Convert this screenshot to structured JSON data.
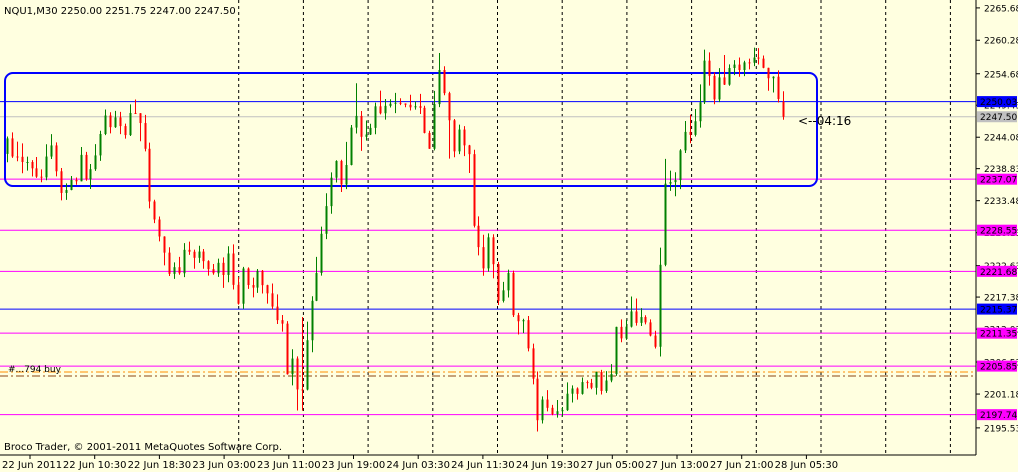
{
  "chart_data": {
    "type": "candlestick",
    "title": "NQU1,M30  2250.00 2251.75 2247.00 2247.50",
    "watermark": "Broco Trader, © 2001-2011 MetaQuotes Software Corp.",
    "countdown_label": "<--04:16",
    "trade_label": "#...794 buy",
    "y_ticks": [
      "2265.68",
      "2260.28",
      "2254.68",
      "2249.43",
      "2244.08",
      "2238.83",
      "2233.48",
      "2228.13",
      "2222.63",
      "2217.38",
      "2212.03",
      "2206.53",
      "2201.18",
      "2195.53"
    ],
    "x_ticks": [
      "22 Jun 2011",
      "22 Jun 10:30",
      "22 Jun 18:30",
      "23 Jun 03:00",
      "23 Jun 11:00",
      "23 Jun 19:00",
      "24 Jun 03:30",
      "24 Jun 11:30",
      "24 Jun 19:30",
      "27 Jun 05:00",
      "27 Jun 13:00",
      "27 Jun 21:00",
      "28 Jun 05:30"
    ],
    "ylim": [
      2191,
      2267
    ],
    "horizontal_lines": [
      {
        "price": 2250.03,
        "label": "2250.03",
        "color": "#0000ff"
      },
      {
        "price": 2247.5,
        "label": "2247.50",
        "color": "#c0c0c0"
      },
      {
        "price": 2237.07,
        "label": "2237.07",
        "color": "#ff00ff"
      },
      {
        "price": 2228.55,
        "label": "2228.55",
        "color": "#ff00ff"
      },
      {
        "price": 2221.68,
        "label": "2221.68",
        "color": "#ff00ff"
      },
      {
        "price": 2215.37,
        "label": "2215.37",
        "color": "#0000ff"
      },
      {
        "price": 2211.35,
        "label": "2211.35",
        "color": "#ff00ff"
      },
      {
        "price": 2205.85,
        "label": "2205.85",
        "color": "#ff00ff"
      },
      {
        "price": 2197.74,
        "label": "2197.74",
        "color": "#ff00ff"
      }
    ],
    "candles": [
      [
        2241.29,
        2243.88,
        2239.9,
        2244.2
      ],
      [
        2243.88,
        2240.86,
        2240.62,
        2244.88
      ],
      [
        2240.86,
        2240.81,
        2240.06,
        2243.34
      ],
      [
        2240.81,
        2239.94,
        2238.07,
        2243.05
      ],
      [
        2239.94,
        2239.94,
        2238.51,
        2240.84
      ],
      [
        2239.94,
        2238.88,
        2237.51,
        2240.26
      ],
      [
        2238.88,
        2237.49,
        2237.29,
        2240.78
      ],
      [
        2237.49,
        2237.37,
        2236.56,
        2238.7
      ],
      [
        2237.37,
        2240.85,
        2236.9,
        2242.91
      ],
      [
        2240.85,
        2242.71,
        2240.45,
        2244.6
      ],
      [
        2242.71,
        2238.39,
        2237.55,
        2243.21
      ],
      [
        2238.39,
        2234.77,
        2233.53,
        2238.94
      ],
      [
        2234.77,
        2235.26,
        2233.62,
        2236.37
      ],
      [
        2235.26,
        2236.94,
        2235.22,
        2237.61
      ],
      [
        2236.94,
        2236.72,
        2236.15,
        2237.36
      ],
      [
        2236.72,
        2241.13,
        2236.71,
        2242.44
      ],
      [
        2241.13,
        2237.04,
        2236.8,
        2241.64
      ],
      [
        2237.04,
        2238.74,
        2235.43,
        2239.6
      ],
      [
        2238.74,
        2241.04,
        2238.45,
        2242.93
      ],
      [
        2241.04,
        2244.62,
        2240.12,
        2245.16
      ],
      [
        2244.62,
        2247.71,
        2244.43,
        2248.71
      ],
      [
        2247.71,
        2245.76,
        2244.72,
        2248.26
      ],
      [
        2245.76,
        2247.39,
        2245.64,
        2248.48
      ],
      [
        2247.39,
        2245.94,
        2244.59,
        2248.32
      ],
      [
        2245.94,
        2244.44,
        2243.85,
        2246.35
      ],
      [
        2244.44,
        2248.13,
        2244.28,
        2249.57
      ],
      [
        2248.13,
        2248.09,
        2247.98,
        2250.39
      ],
      [
        2248.09,
        2246.45,
        2243.4,
        2248.11
      ],
      [
        2246.45,
        2242.15,
        2241.72,
        2247.82
      ],
      [
        2242.15,
        2233.35,
        2232.19,
        2243.18
      ],
      [
        2233.35,
        2230.34,
        2229.73,
        2233.64
      ],
      [
        2230.34,
        2227.5,
        2226.68,
        2230.84
      ],
      [
        2227.5,
        2224.8,
        2222.68,
        2227.54
      ],
      [
        2224.8,
        2221.26,
        2220.89,
        2225.71
      ],
      [
        2221.26,
        2222.37,
        2220.41,
        2223.18
      ],
      [
        2222.37,
        2221.36,
        2221.1,
        2224.1
      ],
      [
        2221.36,
        2225.27,
        2220.72,
        2226.38
      ],
      [
        2225.27,
        2224.95,
        2224.42,
        2226.64
      ],
      [
        2224.95,
        2223.94,
        2222.11,
        2225.3
      ],
      [
        2223.94,
        2224.98,
        2223.09,
        2225.95
      ],
      [
        2224.98,
        2223.38,
        2222.11,
        2225.41
      ],
      [
        2223.38,
        2222.04,
        2220.96,
        2223.54
      ],
      [
        2222.04,
        2221.36,
        2221.1,
        2222.9
      ],
      [
        2221.36,
        2223.1,
        2220.76,
        2223.81
      ],
      [
        2223.1,
        2221.07,
        2218.92,
        2224.01
      ],
      [
        2221.07,
        2224.66,
        2219.86,
        2225.86
      ],
      [
        2224.66,
        2219.42,
        2218.64,
        2226.18
      ],
      [
        2219.42,
        2216.27,
        2216.12,
        2220.71
      ],
      [
        2216.27,
        2222.15,
        2215.42,
        2222.42
      ],
      [
        2222.15,
        2219.39,
        2218.75,
        2222.35
      ],
      [
        2219.39,
        2218.96,
        2217.33,
        2220.62
      ],
      [
        2218.96,
        2221.77,
        2218.07,
        2222.06
      ],
      [
        2221.77,
        2219.37,
        2217.98,
        2221.91
      ],
      [
        2219.37,
        2218.0,
        2216.29,
        2219.43
      ],
      [
        2218.0,
        2215.79,
        2215.33,
        2219.64
      ],
      [
        2215.79,
        2213.53,
        2212.88,
        2217.82
      ],
      [
        2213.53,
        2212.94,
        2211.61,
        2214.38
      ],
      [
        2212.94,
        2204.49,
        2204.42,
        2213.37
      ],
      [
        2204.49,
        2207.11,
        2202.62,
        2208.67
      ],
      [
        2207.11,
        2201.95,
        2198.44,
        2207.48
      ],
      [
        2201.95,
        2201.93,
        2198.42,
        2214.05
      ],
      [
        2201.93,
        2210.17,
        2201.79,
        2213.27
      ],
      [
        2210.17,
        2216.76,
        2208.17,
        2217.52
      ],
      [
        2216.76,
        2221.4,
        2216.71,
        2224.1
      ],
      [
        2221.4,
        2227.95,
        2220.96,
        2229.15
      ],
      [
        2227.95,
        2232.57,
        2227.06,
        2234.72
      ],
      [
        2232.57,
        2237.32,
        2231.29,
        2238.2
      ],
      [
        2237.32,
        2240.11,
        2236.52,
        2240.24
      ],
      [
        2240.11,
        2236.19,
        2234.92,
        2240.31
      ],
      [
        2236.19,
        2239.44,
        2235.42,
        2243.31
      ],
      [
        2239.44,
        2245.69,
        2239.37,
        2246.12
      ],
      [
        2245.69,
        2247.64,
        2244.7,
        2253.09
      ],
      [
        2247.64,
        2244.15,
        2241.8,
        2248.45
      ],
      [
        2244.15,
        2244.53,
        2243.52,
        2246.87
      ],
      [
        2244.53,
        2245.64,
        2244.46,
        2246.34
      ],
      [
        2245.64,
        2249.24,
        2244.58,
        2249.85
      ],
      [
        2249.24,
        2248.08,
        2247.89,
        2251.86
      ],
      [
        2248.08,
        2249.32,
        2247.01,
        2250.47
      ],
      [
        2249.32,
        2249.68,
        2249.05,
        2250.43
      ],
      [
        2249.68,
        2249.83,
        2248.11,
        2251.48
      ],
      [
        2249.83,
        2249.72,
        2249.45,
        2250.59
      ],
      [
        2249.72,
        2249.5,
        2249.08,
        2249.74
      ],
      [
        2249.5,
        2249.07,
        2248.55,
        2251.17
      ],
      [
        2249.07,
        2249.26,
        2248.68,
        2250.07
      ],
      [
        2249.26,
        2248.99,
        2247.95,
        2251.31
      ],
      [
        2248.99,
        2244.8,
        2244.72,
        2249.33
      ],
      [
        2244.8,
        2242.15,
        2242.13,
        2245.17
      ],
      [
        2242.15,
        2249.61,
        2241.88,
        2251.82
      ],
      [
        2249.61,
        2255.31,
        2249.11,
        2258.15
      ],
      [
        2255.31,
        2251.44,
        2251.09,
        2255.93
      ],
      [
        2251.44,
        2246.91,
        2240.5,
        2251.67
      ],
      [
        2246.91,
        2241.72,
        2240.74,
        2247.13
      ],
      [
        2241.72,
        2245.36,
        2241.26,
        2246.19
      ],
      [
        2245.36,
        2242.72,
        2240.92,
        2245.94
      ],
      [
        2242.72,
        2241.25,
        2238.1,
        2242.8
      ],
      [
        2241.25,
        2229.29,
        2228.99,
        2241.99
      ],
      [
        2229.29,
        2225.72,
        2224.34,
        2230.86
      ],
      [
        2225.72,
        2222.17,
        2220.95,
        2227.79
      ],
      [
        2222.17,
        2227.36,
        2221.63,
        2228.02
      ],
      [
        2227.36,
        2222.87,
        2220.51,
        2227.88
      ],
      [
        2222.87,
        2216.74,
        2216.06,
        2223.26
      ],
      [
        2216.74,
        2218.5,
        2216.48,
        2219.91
      ],
      [
        2218.5,
        2221.41,
        2217.3,
        2221.97
      ],
      [
        2221.41,
        2214.36,
        2214.06,
        2221.8
      ],
      [
        2214.36,
        2213.34,
        2211.12,
        2214.74
      ],
      [
        2213.34,
        2213.53,
        2211.35,
        2213.75
      ],
      [
        2213.53,
        2208.81,
        2208.31,
        2214.22
      ],
      [
        2208.81,
        2203.75,
        2202.8,
        2209.6
      ],
      [
        2203.75,
        2196.81,
        2194.92,
        2204.94
      ],
      [
        2196.81,
        2200.26,
        2196.27,
        2200.79
      ],
      [
        2200.26,
        2198.88,
        2198.28,
        2201.84
      ],
      [
        2198.88,
        2197.82,
        2197.63,
        2199.37
      ],
      [
        2197.82,
        2198.31,
        2197.24,
        2200.19
      ],
      [
        2198.31,
        2198.49,
        2197.46,
        2199.02
      ],
      [
        2198.49,
        2201.24,
        2198.38,
        2203.13
      ],
      [
        2201.24,
        2202.11,
        2199.76,
        2202.63
      ],
      [
        2202.11,
        2201.21,
        2200.25,
        2202.29
      ],
      [
        2201.21,
        2203.18,
        2201.09,
        2203.95
      ],
      [
        2203.18,
        2203.04,
        2202.11,
        2203.46
      ],
      [
        2203.04,
        2202.23,
        2201.99,
        2203.72
      ],
      [
        2202.23,
        2204.87,
        2201.08,
        2204.91
      ],
      [
        2204.87,
        2201.7,
        2201.11,
        2205.22
      ],
      [
        2201.7,
        2203.44,
        2201.38,
        2205.01
      ],
      [
        2203.44,
        2204.52,
        2203.16,
        2206.18
      ],
      [
        2204.52,
        2212.4,
        2204.21,
        2212.43
      ],
      [
        2212.4,
        2210.48,
        2209.84,
        2213.66
      ],
      [
        2210.48,
        2212.44,
        2210.22,
        2213.56
      ],
      [
        2212.44,
        2214.98,
        2212.3,
        2217.47
      ],
      [
        2214.98,
        2213.07,
        2212.62,
        2217.14
      ],
      [
        2213.07,
        2214.04,
        2212.54,
        2215.54
      ],
      [
        2214.04,
        2213.15,
        2212.82,
        2214.34
      ],
      [
        2213.15,
        2210.95,
        2210.81,
        2213.66
      ],
      [
        2210.95,
        2209.08,
        2208.79,
        2211.76
      ],
      [
        2209.08,
        2222.77,
        2207.45,
        2225.63
      ],
      [
        2222.77,
        2236.32,
        2222.52,
        2240.47
      ],
      [
        2236.32,
        2236.59,
        2235.12,
        2238.5
      ],
      [
        2236.59,
        2236.92,
        2234.23,
        2238.23
      ],
      [
        2236.92,
        2241.88,
        2235.41,
        2242.1
      ],
      [
        2241.88,
        2244.97,
        2241.45,
        2246.79
      ],
      [
        2244.97,
        2244.47,
        2243.07,
        2247.85
      ],
      [
        2244.47,
        2246.75,
        2244.19,
        2248.79
      ],
      [
        2246.75,
        2249.92,
        2245.69,
        2252.91
      ],
      [
        2249.92,
        2256.87,
        2249.62,
        2258.71
      ],
      [
        2256.87,
        2254.33,
        2252.7,
        2258.25
      ],
      [
        2254.33,
        2250.39,
        2249.59,
        2254.92
      ],
      [
        2250.39,
        2254.07,
        2249.95,
        2255.62
      ],
      [
        2254.07,
        2252.86,
        2252.81,
        2257.82
      ],
      [
        2252.86,
        2255.64,
        2252.68,
        2256.25
      ],
      [
        2255.64,
        2256.21,
        2254.46,
        2256.96
      ],
      [
        2256.21,
        2255.3,
        2254.17,
        2257.39
      ],
      [
        2255.3,
        2256.58,
        2254.28,
        2256.86
      ],
      [
        2256.58,
        2256.52,
        2255.41,
        2257.21
      ],
      [
        2256.52,
        2257.39,
        2255.96,
        2259.04
      ],
      [
        2257.39,
        2257.21,
        2256.22,
        2258.96
      ],
      [
        2257.21,
        2255.67,
        2255.61,
        2257.72
      ],
      [
        2255.67,
        2253.93,
        2251.84,
        2255.69
      ],
      [
        2253.93,
        2254.19,
        2251.54,
        2254.27
      ],
      [
        2254.19,
        2250.47,
        2249.87,
        2255.24
      ],
      [
        2250.0,
        2247.5,
        2247.0,
        2251.75
      ]
    ]
  }
}
